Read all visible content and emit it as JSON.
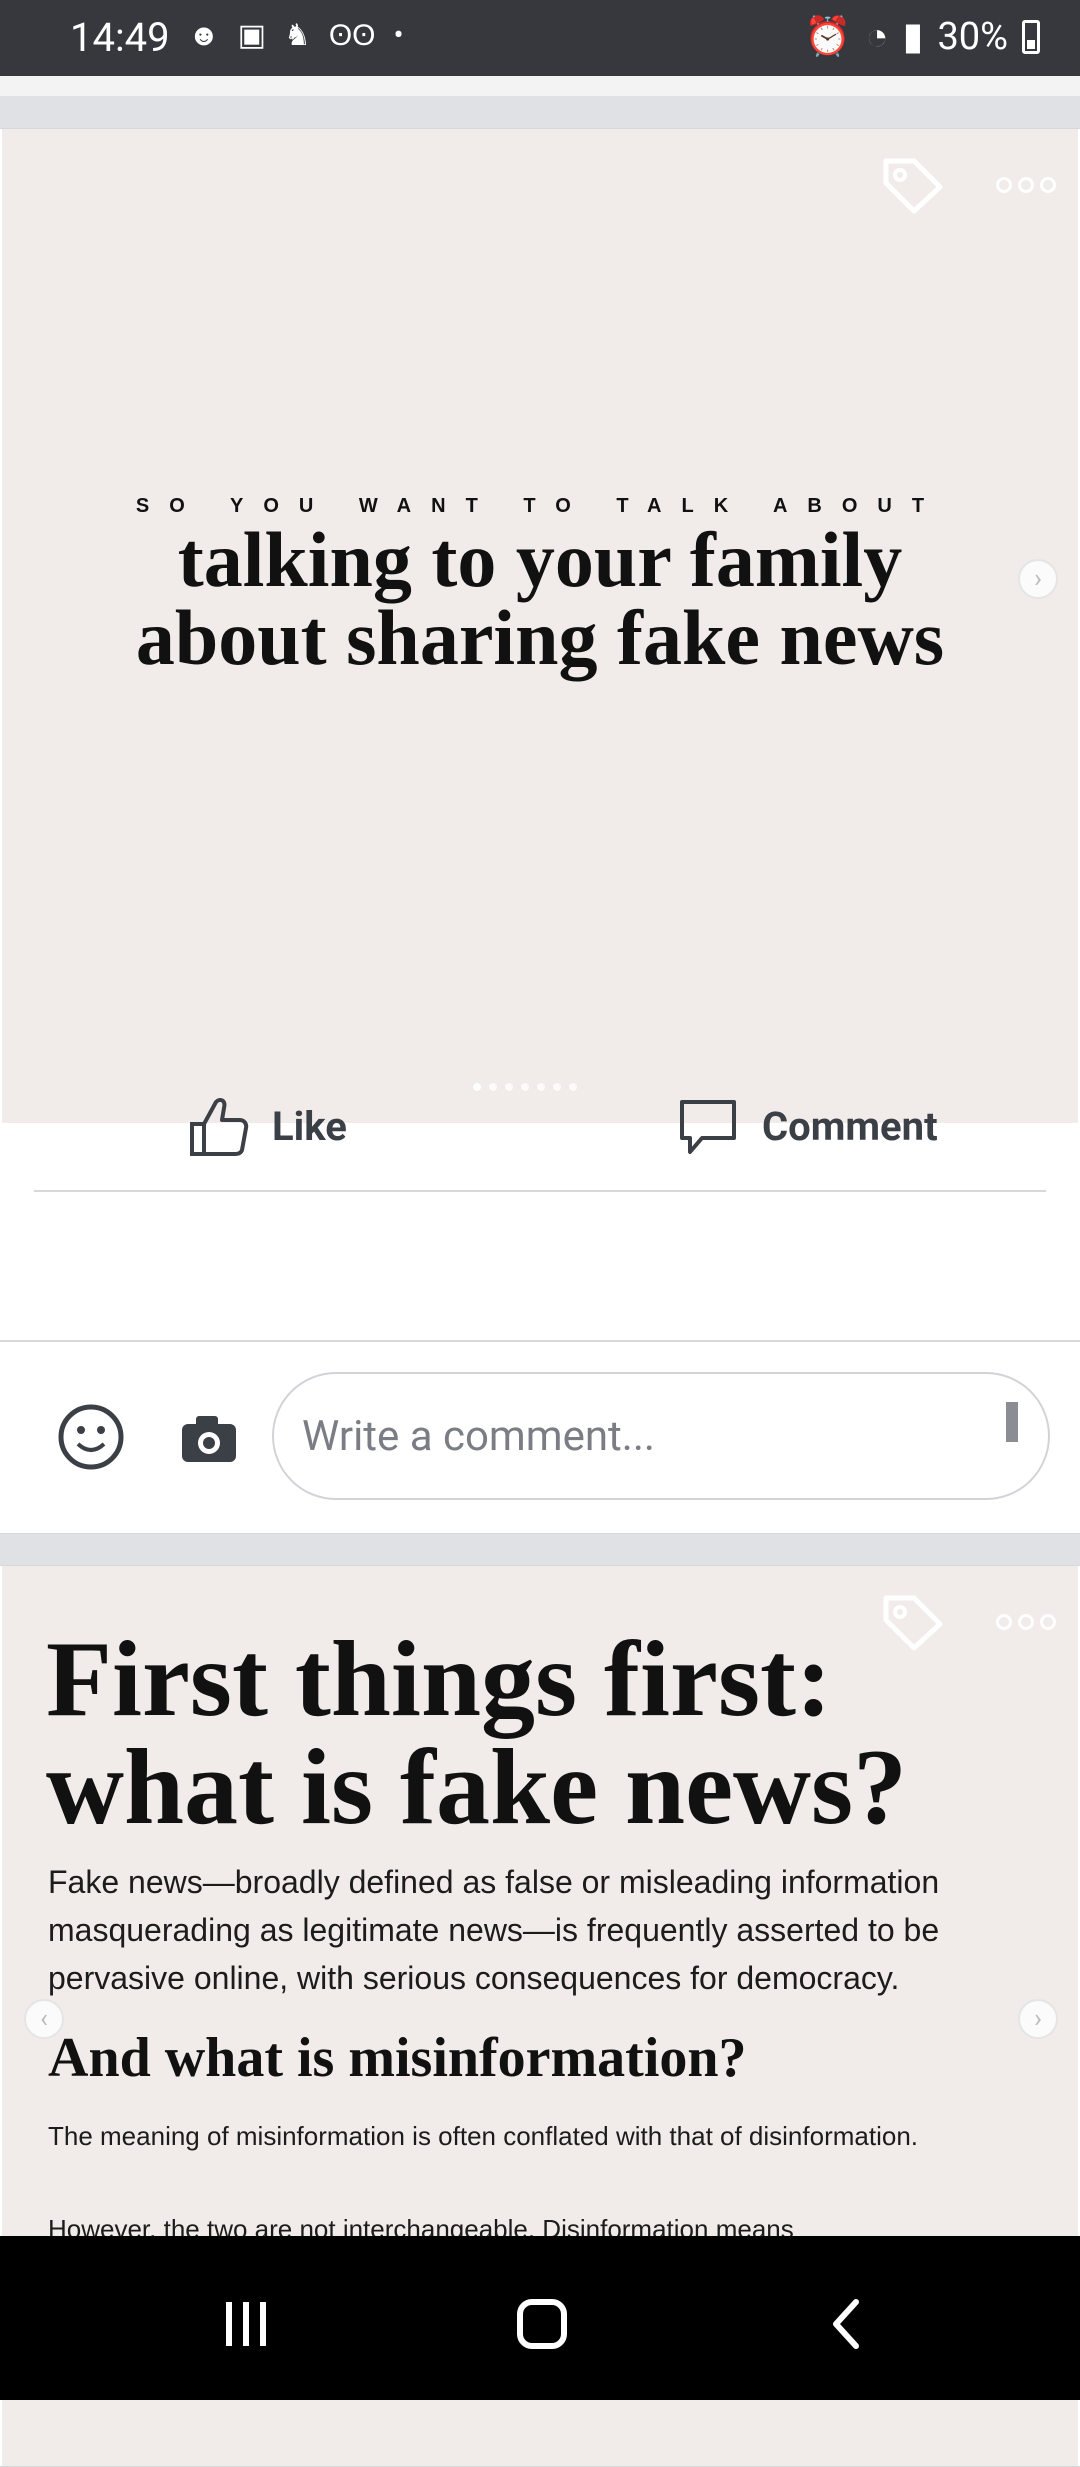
{
  "status_bar": {
    "time": "14:49",
    "battery_text": "30%"
  },
  "post1": {
    "kicker": "SO YOU WANT TO TALK ABOUT",
    "headline_line1": "talking to your family",
    "headline_line2": "about sharing fake news",
    "dots": 7,
    "actions": {
      "like": "Like",
      "comment": "Comment"
    },
    "composer": {
      "placeholder": "Write a comment..."
    }
  },
  "post2": {
    "title_line1": "First things first:",
    "title_line2": "what is fake news?",
    "body": "Fake news—broadly defined as false or misleading information masquerading as legitimate news—is frequently asserted to be pervasive online, with serious consequences for democracy.",
    "subheading": "And what is misinformation?",
    "body2": "The meaning of misinformation is often conflated with that of disinformation.",
    "body3": "However, the two are not interchangeable. Disinformation means"
  },
  "colors": {
    "status_bg": "#36383d",
    "image_bg": "#f1ebea",
    "text_dark": "#111111"
  }
}
